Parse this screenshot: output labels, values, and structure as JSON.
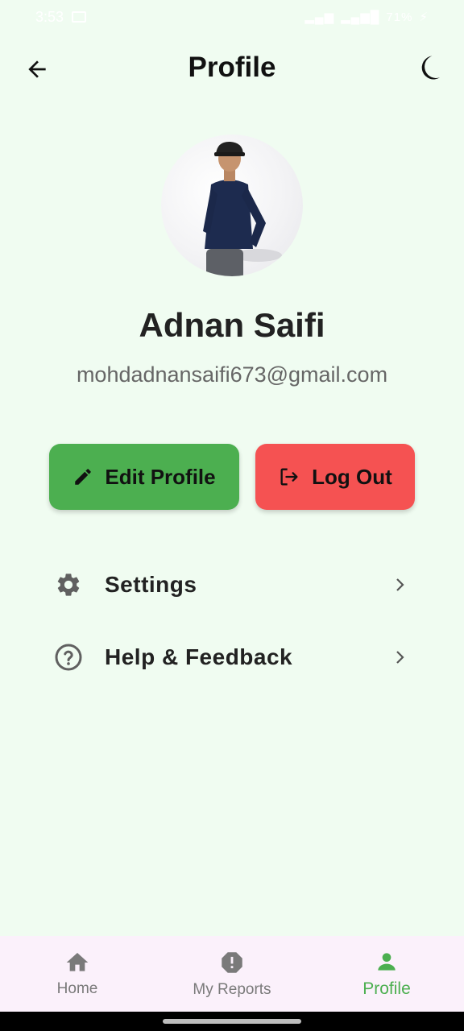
{
  "status_bar": {
    "time": "3:53",
    "battery": "71%"
  },
  "header": {
    "title": "Profile"
  },
  "profile": {
    "name": "Adnan Saifi",
    "email": "mohdadnansaifi673@gmail.com"
  },
  "actions": {
    "edit_label": "Edit Profile",
    "logout_label": "Log Out"
  },
  "menu": [
    {
      "label": "Settings",
      "icon": "gear-icon"
    },
    {
      "label": "Help & Feedback",
      "icon": "help-circle-icon"
    }
  ],
  "bottom_nav": [
    {
      "label": "Home",
      "icon": "home-icon",
      "active": false
    },
    {
      "label": "My Reports",
      "icon": "report-icon",
      "active": false
    },
    {
      "label": "Profile",
      "icon": "person-icon",
      "active": true
    }
  ],
  "colors": {
    "background": "#f0fcf1",
    "edit_button": "#4caf50",
    "logout_button": "#f55252",
    "active_nav": "#4caf50",
    "nav_background": "#fbf1fb"
  }
}
